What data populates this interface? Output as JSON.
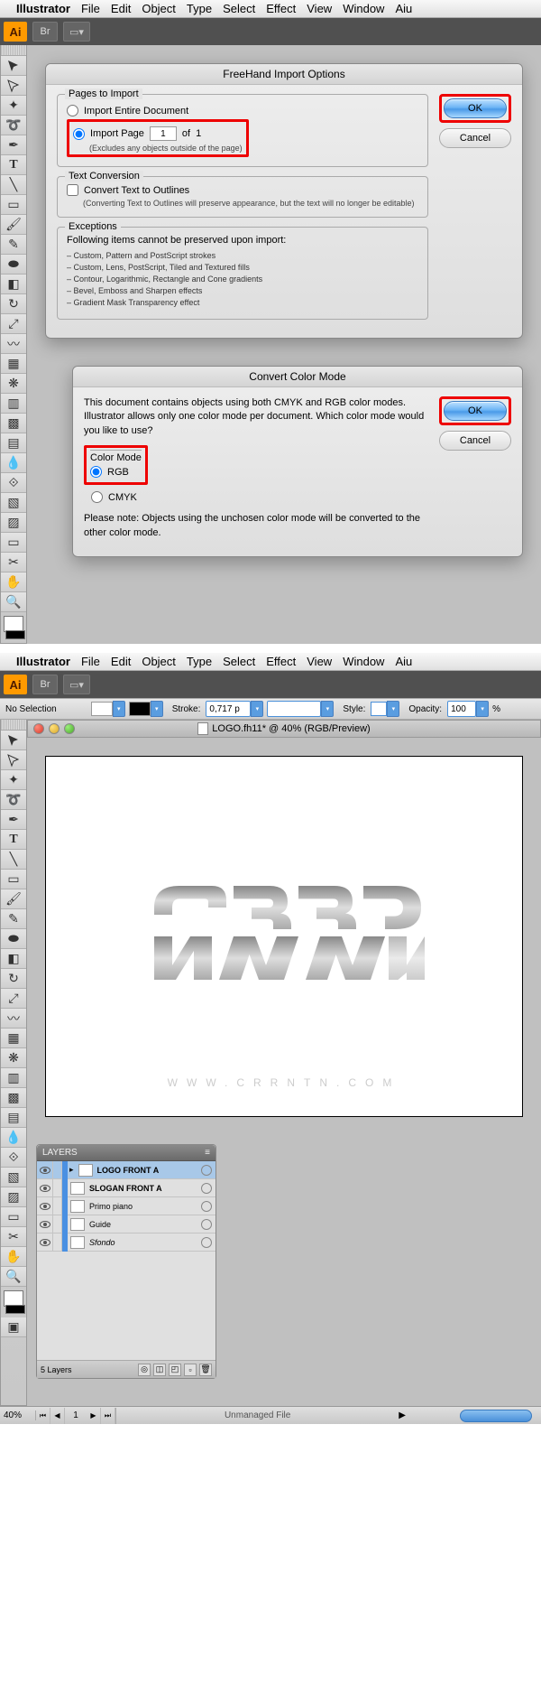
{
  "menu": {
    "apple": "",
    "app": "Illustrator",
    "items": [
      "File",
      "Edit",
      "Object",
      "Type",
      "Select",
      "Effect",
      "View",
      "Window",
      "Aiu"
    ]
  },
  "toolbar": {
    "ai": "Ai",
    "br": "Br"
  },
  "dialog1": {
    "title": "FreeHand Import Options",
    "pages": {
      "legend": "Pages to Import",
      "entire": "Import Entire Document",
      "page": "Import Page",
      "pageval": "1",
      "of": "of",
      "total": "1",
      "excl": "(Excludes any objects outside of the page)"
    },
    "textconv": {
      "legend": "Text Conversion",
      "chk": "Convert Text to Outlines",
      "note": "(Converting Text to Outlines will preserve appearance, but the text will no longer be editable)"
    },
    "exc": {
      "legend": "Exceptions",
      "head": "Following items cannot be preserved upon import:",
      "items": [
        "– Custom, Pattern and PostScript strokes",
        "– Custom, Lens, PostScript, Tiled and Textured fills",
        "– Contour, Logarithmic, Rectangle and Cone gradients",
        "– Bevel, Emboss and Sharpen effects",
        "– Gradient Mask Transparency effect"
      ]
    },
    "ok": "OK",
    "cancel": "Cancel"
  },
  "dialog2": {
    "title": "Convert Color Mode",
    "body": "This document contains objects using both CMYK and RGB color modes.  Illustrator allows only one color mode per document.  Which color mode would you like to use?",
    "legend": "Color Mode",
    "rgb": "RGB",
    "cmyk": "CMYK",
    "note": "Please note: Objects using the unchosen color mode will be converted to the other color mode.",
    "ok": "OK",
    "cancel": "Cancel"
  },
  "control": {
    "nosel": "No Selection",
    "stroke": "Stroke:",
    "strokeval": "0,717 p",
    "style": "Style:",
    "opacity": "Opacity:",
    "opval": "100",
    "pct": "%"
  },
  "doc": {
    "title": "LOGO.fh11* @ 40% (RGB/Preview)",
    "url": "WWW.CRRNTN.COM"
  },
  "layers": {
    "title": "LAYERS",
    "rows": [
      {
        "name": "LOGO FRONT A",
        "sel": true,
        "bold": true,
        "expand": true
      },
      {
        "name": "SLOGAN FRONT A",
        "bold": true
      },
      {
        "name": "Primo piano",
        "italic": false
      },
      {
        "name": "Guide"
      },
      {
        "name": "Sfondo",
        "italic": true
      }
    ],
    "count": "5 Layers"
  },
  "status": {
    "zoom": "40%",
    "page": "1",
    "file": "Unmanaged File"
  }
}
